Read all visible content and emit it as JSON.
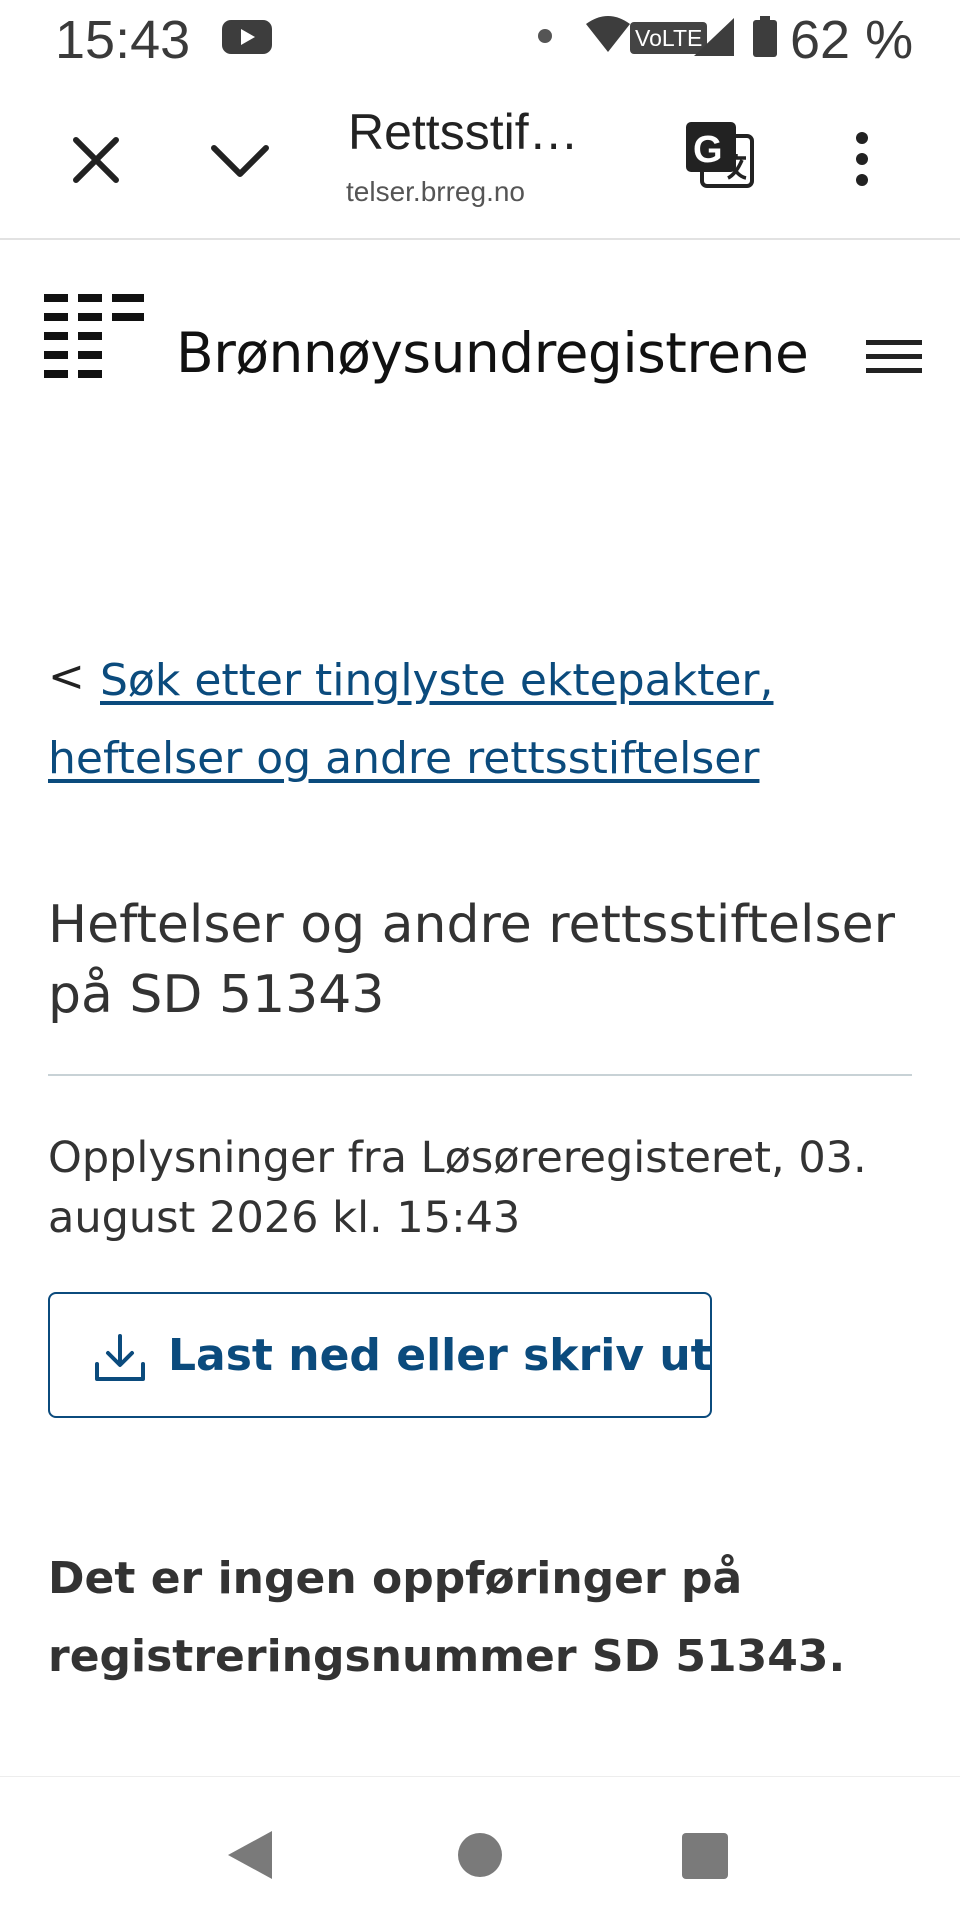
{
  "status_bar": {
    "time": "15:43",
    "network_badge": "VoLTE",
    "battery_percent": "62 %",
    "icons": [
      "youtube-icon",
      "notification-dot-icon",
      "wifi-icon",
      "signal-icon",
      "battery-icon"
    ]
  },
  "browser": {
    "tab_title": "Rettsstif…",
    "url_fragment": "telser.brreg.no",
    "icons": [
      "close-icon",
      "chevron-down-icon",
      "translate-icon",
      "more-vert-icon"
    ]
  },
  "site": {
    "name": "Brønnøysundregistrene",
    "icons": [
      "brreg-logo-icon",
      "hamburger-menu-icon"
    ]
  },
  "breadcrumb": {
    "chevron": "<",
    "link_text": "Søk etter tinglyste ektepakter, heftelser og andre rettsstiftelser"
  },
  "page": {
    "title": "Heftelser og andre rettsstiftelser på SD 51343",
    "info": "Opplysninger fra Løsøreregisteret, 03. august 2026 kl. 15:43",
    "download_label": "Last ned eller skriv ut",
    "empty_message": "Det er ingen oppføringer på registreringsnummer SD 51343."
  },
  "colors": {
    "link": "#0b4b7d",
    "text": "#333333",
    "divider": "#c8d2d6"
  },
  "nav_bar": {
    "icons": [
      "back-triangle-icon",
      "home-circle-icon",
      "recents-square-icon"
    ]
  }
}
